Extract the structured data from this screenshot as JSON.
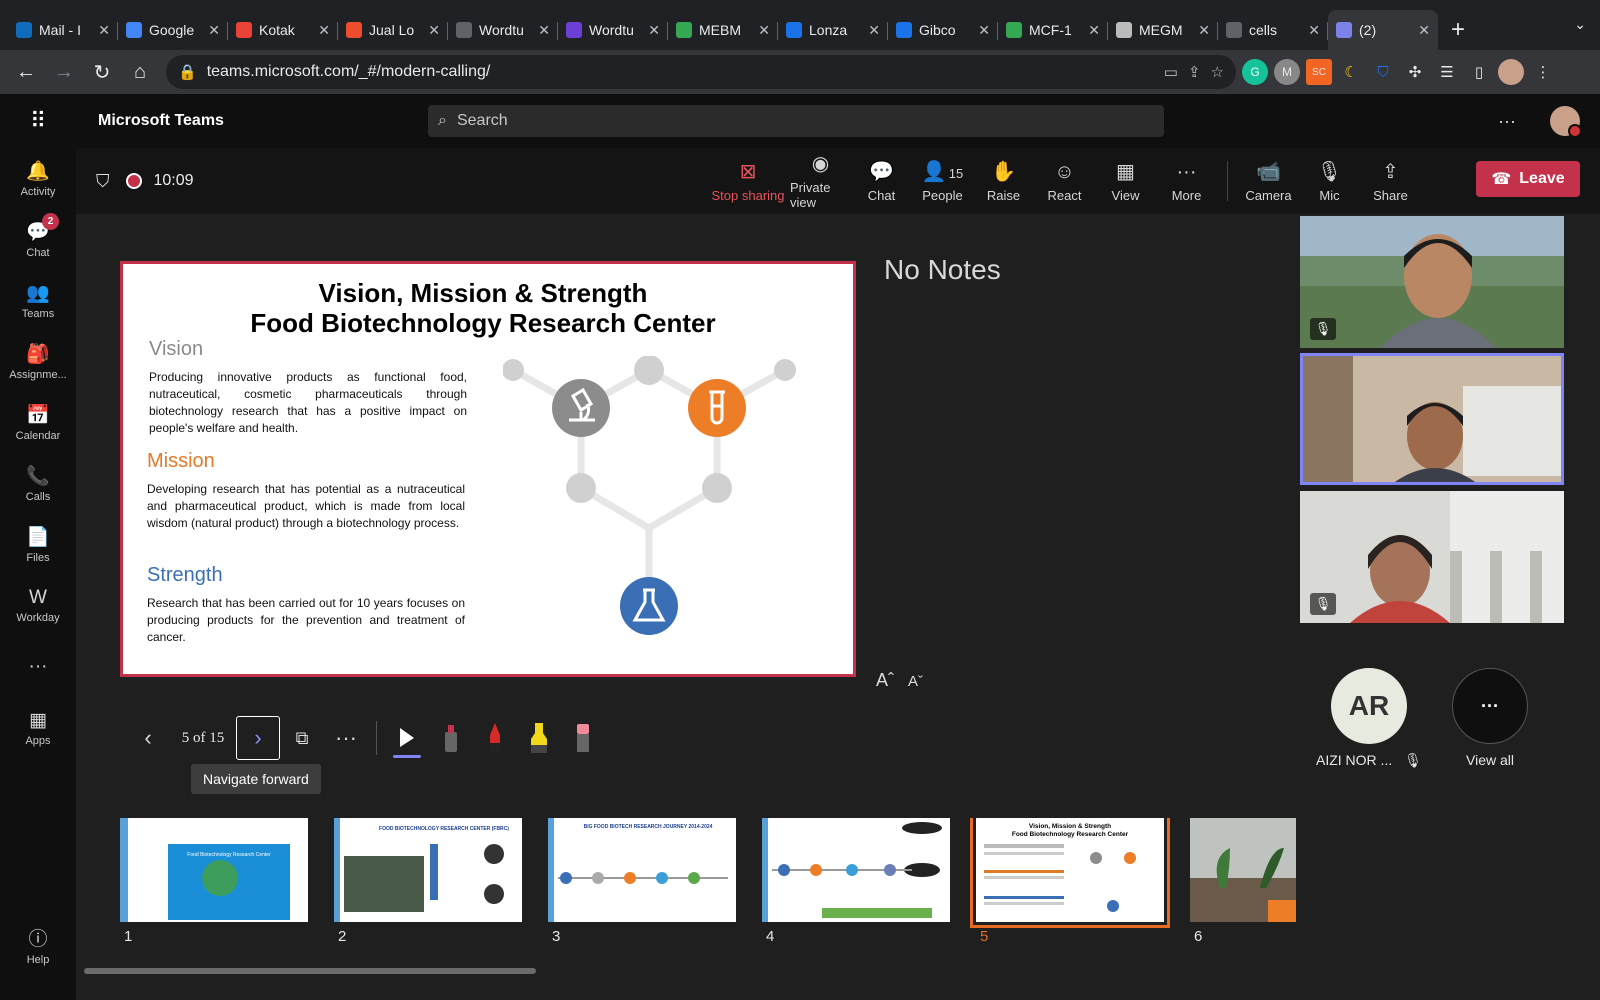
{
  "browser": {
    "tabs": [
      {
        "title": "Mail - I",
        "color": "#0f6cbd"
      },
      {
        "title": "Google",
        "color": "#4285f4"
      },
      {
        "title": "Kotak",
        "color": "#ea4335"
      },
      {
        "title": "Jual Lo",
        "color": "#ee4d2d"
      },
      {
        "title": "Wordtu",
        "color": "#5f6368"
      },
      {
        "title": "Wordtu",
        "color": "#6b3fd6"
      },
      {
        "title": "MEBM",
        "color": "#34a853"
      },
      {
        "title": "Lonza",
        "color": "#1a73e8"
      },
      {
        "title": "Gibco",
        "color": "#1a73e8"
      },
      {
        "title": "MCF-1",
        "color": "#34a853"
      },
      {
        "title": "MEGM",
        "color": "#bbbbbb"
      },
      {
        "title": "cells",
        "color": "#5f6368"
      },
      {
        "title": "(2)",
        "color": "#7b83eb"
      }
    ],
    "new_tab": "+",
    "url": "teams.microsoft.com/_#/modern-calling/"
  },
  "teams": {
    "app_title": "Microsoft Teams",
    "search_placeholder": "Search"
  },
  "rail": [
    {
      "label": "Activity",
      "icon": "bell-icon",
      "glyph": "🔔"
    },
    {
      "label": "Chat",
      "icon": "chat-icon",
      "glyph": "💬",
      "badge": "2"
    },
    {
      "label": "Teams",
      "icon": "teams-icon",
      "glyph": "👥"
    },
    {
      "label": "Assignme...",
      "icon": "assignments-icon",
      "glyph": "🎒"
    },
    {
      "label": "Calendar",
      "icon": "calendar-icon",
      "glyph": "📅"
    },
    {
      "label": "Calls",
      "icon": "phone-icon",
      "glyph": "📞"
    },
    {
      "label": "Files",
      "icon": "file-icon",
      "glyph": "📄"
    },
    {
      "label": "Workday",
      "icon": "workday-icon",
      "glyph": "W"
    },
    {
      "label": "",
      "icon": "more-icon",
      "glyph": "···"
    },
    {
      "label": "Apps",
      "icon": "apps-icon",
      "glyph": "▦"
    }
  ],
  "rail_help": "Help",
  "meeting": {
    "timer": "10:09",
    "controls": [
      {
        "label": "Stop sharing",
        "icon": "stop-share-icon"
      },
      {
        "label": "Private view",
        "icon": "eye-icon"
      },
      {
        "label": "Chat",
        "icon": "chat-icon"
      },
      {
        "label": "People",
        "icon": "people-icon",
        "count": "15"
      },
      {
        "label": "Raise",
        "icon": "hand-icon"
      },
      {
        "label": "React",
        "icon": "smiley-icon"
      },
      {
        "label": "View",
        "icon": "grid-icon"
      },
      {
        "label": "More",
        "icon": "more-icon"
      },
      {
        "label": "Camera",
        "icon": "camera-icon"
      },
      {
        "label": "Mic",
        "icon": "mic-off-icon"
      },
      {
        "label": "Share",
        "icon": "share-icon"
      }
    ],
    "leave_label": "Leave"
  },
  "slide": {
    "title_line1": "Vision, Mission & Strength",
    "title_line2": "Food Biotechnology Research Center",
    "vision_head": "Vision",
    "vision_text": "Producing innovative products as functional food, nutraceutical, cosmetic pharmaceuticals through biotechnology research that has a positive impact on people's welfare and health.",
    "mission_head": "Mission",
    "mission_text": "Developing research that has potential as a nutraceutical and pharmaceutical product, which is made from local wisdom (natural product) through a biotechnology process.",
    "strength_head": "Strength",
    "strength_text": "Research that has been carried out for 10 years focuses on producing products for the prevention and treatment of cancer.",
    "colors": {
      "vision": "#8a8a8a",
      "mission": "#e07b2a",
      "strength": "#3a6fb5"
    }
  },
  "notes_text": "No Notes",
  "presenter": {
    "counter": "5 of 15",
    "tooltip": "Navigate forward"
  },
  "participants": {
    "ar_initials": "AR",
    "ar_name": "AIZI NOR ...",
    "view_all": "View all"
  },
  "thumbnails": [
    {
      "num": "1",
      "title": "Food Biotechnology Research Center"
    },
    {
      "num": "2",
      "title": "FOOD BIOTECHNOLOGY RESEARCH CENTER (FBRC)"
    },
    {
      "num": "3",
      "title": "BIG FOOD BIOTECH RESEARCH JOURNEY 2014-2024"
    },
    {
      "num": "4",
      "title": ""
    },
    {
      "num": "5",
      "title": "Vision, Mission & Strength Food Biotechnology Research Center"
    },
    {
      "num": "6",
      "title": ""
    }
  ]
}
